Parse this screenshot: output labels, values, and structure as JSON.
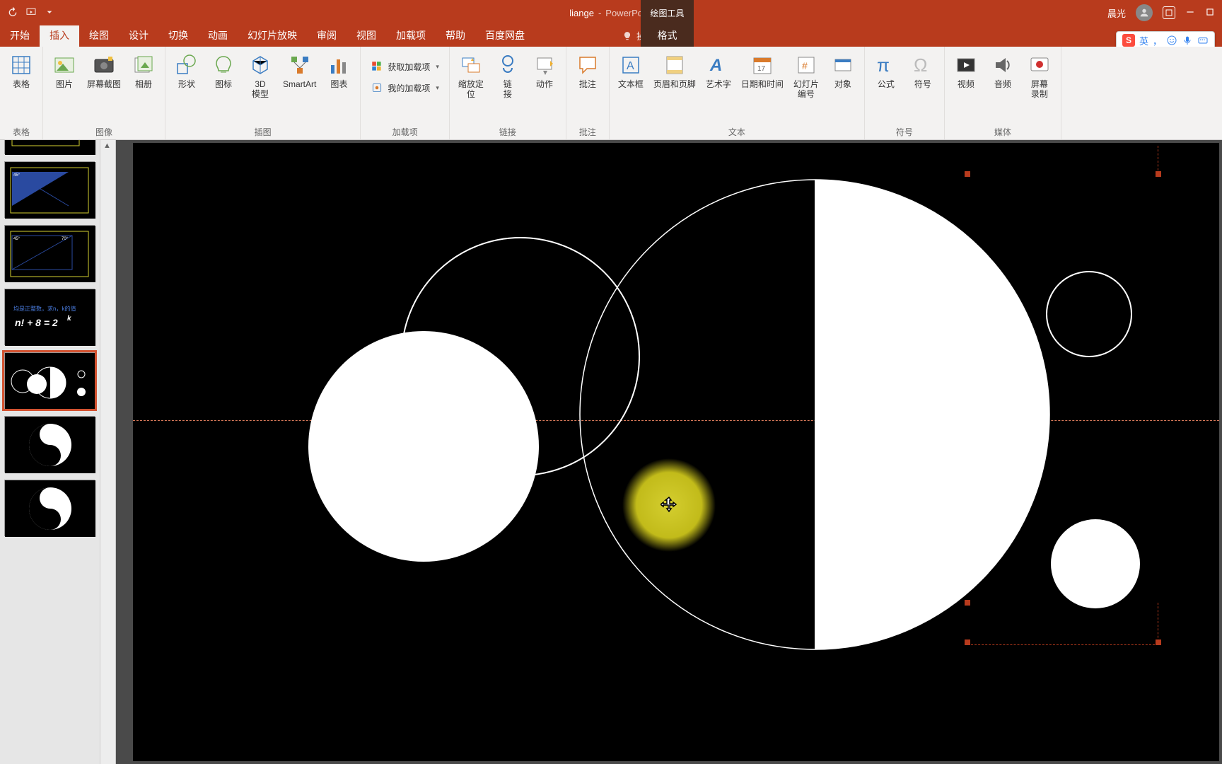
{
  "titlebar": {
    "document": "liange",
    "app": "PowerPoint",
    "context_tool": "绘图工具",
    "user": "晨光"
  },
  "tabs": {
    "items": [
      "开始",
      "插入",
      "绘图",
      "设计",
      "切换",
      "动画",
      "幻灯片放映",
      "审阅",
      "视图",
      "加载项",
      "帮助",
      "百度网盘",
      "格式"
    ],
    "active_index": 1,
    "tell_me": "操作说明搜索"
  },
  "ribbon": {
    "groups": [
      {
        "label": "表格",
        "items": [
          {
            "t": "表格",
            "i": "table"
          }
        ]
      },
      {
        "label": "图像",
        "items": [
          {
            "t": "图片",
            "i": "pic"
          },
          {
            "t": "屏幕截图",
            "i": "screenshot"
          },
          {
            "t": "相册",
            "i": "album"
          }
        ]
      },
      {
        "label": "插图",
        "items": [
          {
            "t": "形状",
            "i": "shapes"
          },
          {
            "t": "图标",
            "i": "icons"
          },
          {
            "t": "3D\n模型",
            "i": "3d"
          },
          {
            "t": "SmartArt",
            "i": "smartart"
          },
          {
            "t": "图表",
            "i": "chart"
          }
        ]
      },
      {
        "label": "加载项",
        "small": [
          {
            "t": "获取加载项",
            "i": "store"
          },
          {
            "t": "我的加载项",
            "i": "myaddins"
          }
        ]
      },
      {
        "label": "链接",
        "items": [
          {
            "t": "缩放定\n位",
            "i": "zoom"
          },
          {
            "t": "链\n接",
            "i": "link"
          },
          {
            "t": "动作",
            "i": "action"
          }
        ]
      },
      {
        "label": "批注",
        "items": [
          {
            "t": "批注",
            "i": "comment"
          }
        ]
      },
      {
        "label": "文本",
        "items": [
          {
            "t": "文本框",
            "i": "textbox"
          },
          {
            "t": "页眉和页脚",
            "i": "headerfooter"
          },
          {
            "t": "艺术字",
            "i": "wordart"
          },
          {
            "t": "日期和时间",
            "i": "datetime"
          },
          {
            "t": "幻灯片\n编号",
            "i": "slidenum"
          },
          {
            "t": "对象",
            "i": "object"
          }
        ]
      },
      {
        "label": "符号",
        "items": [
          {
            "t": "公式",
            "i": "equation"
          },
          {
            "t": "符号",
            "i": "symbol"
          }
        ]
      },
      {
        "label": "媒体",
        "items": [
          {
            "t": "视频",
            "i": "video"
          },
          {
            "t": "音频",
            "i": "audio"
          },
          {
            "t": "屏幕\n录制",
            "i": "screenrec"
          }
        ]
      }
    ]
  },
  "ime": {
    "logo": "S",
    "lang": "英"
  }
}
